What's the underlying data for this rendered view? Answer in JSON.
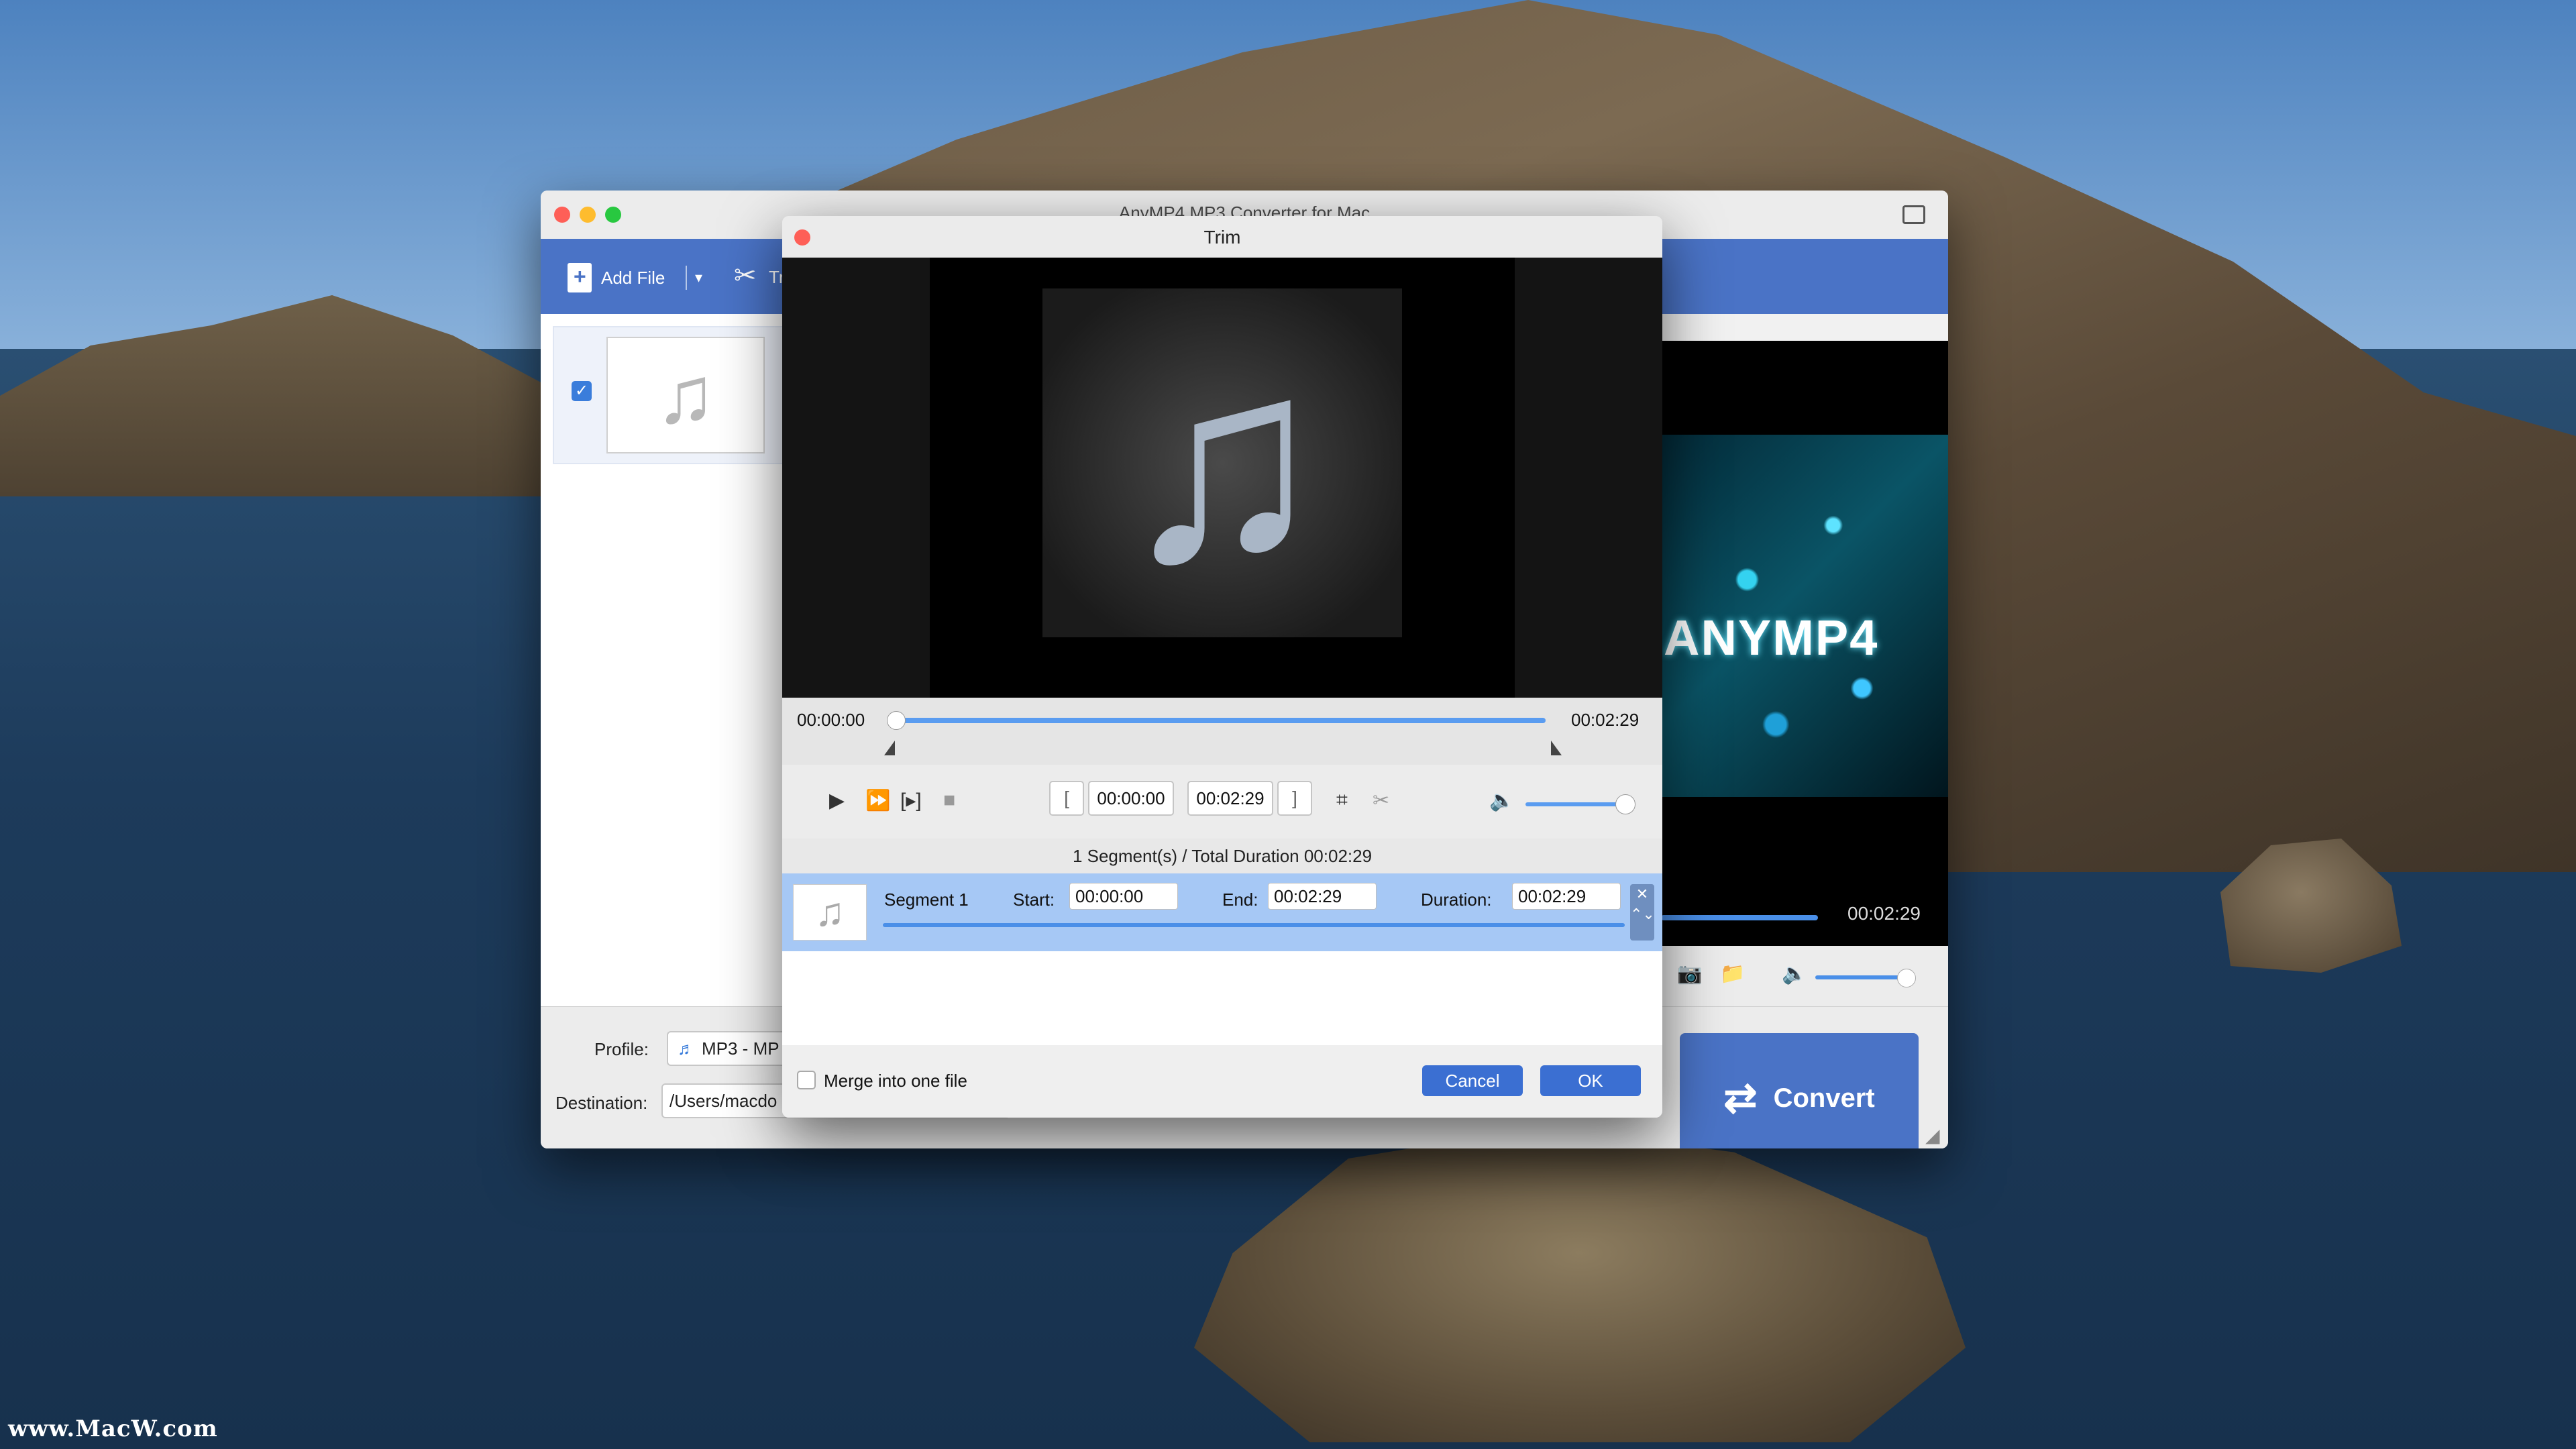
{
  "watermark": "www.MacW.com",
  "main_window": {
    "title": "AnyMP4 MP3 Converter for Mac",
    "toolbar": {
      "add_file_label": "Add File",
      "dropdown_glyph": "▾",
      "trim_label": "Tr"
    },
    "file_item": {
      "checked": true,
      "thumbnail_icon": "music-note-icon"
    },
    "profile": {
      "label": "Profile:",
      "value": "MP3 - MP"
    },
    "destination": {
      "label": "Destination:",
      "value": "/Users/macdo"
    },
    "convert_label": "Convert",
    "preview": {
      "brand_text": "ANYMP4",
      "time": "00:02:29",
      "volume_fraction": 0.9
    }
  },
  "trim_dialog": {
    "title": "Trim",
    "timeline": {
      "start_time": "00:00:00",
      "end_time": "00:02:29"
    },
    "controls": {
      "start_field": "00:00:00",
      "end_field": "00:02:29",
      "volume_fraction": 0.9
    },
    "segment_summary": "1 Segment(s) / Total Duration 00:02:29",
    "segments": [
      {
        "name": "Segment 1",
        "start_label": "Start:",
        "start_value": "00:00:00",
        "end_label": "End:",
        "end_value": "00:02:29",
        "duration_label": "Duration:",
        "duration_value": "00:02:29"
      }
    ],
    "merge_label": "Merge into one file",
    "merge_checked": false,
    "cancel_label": "Cancel",
    "ok_label": "OK"
  },
  "colors": {
    "accent": "#4a73c6",
    "button_blue": "#3b6fd2",
    "segment_highlight": "#a6c8f5",
    "progress_blue": "#5a9cf0"
  }
}
